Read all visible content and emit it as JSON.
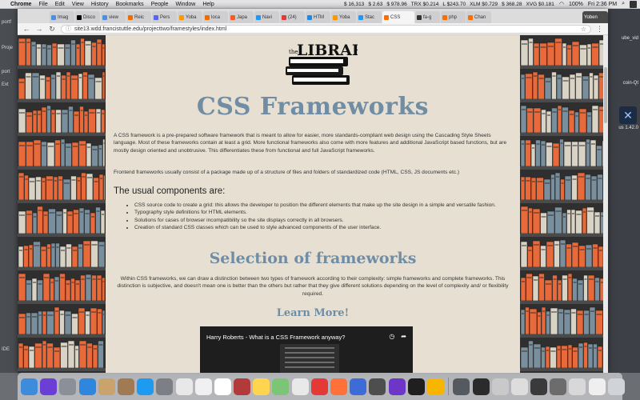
{
  "menubar": {
    "app_name": "Chrome",
    "menus": [
      "File",
      "Edit",
      "View",
      "History",
      "Bookmarks",
      "People",
      "Window",
      "Help"
    ],
    "ticker": [
      "$ 16,313",
      "$ 2.63",
      "$ 978.96",
      "TRX $0.214",
      "L $243.70",
      "XLM $0.729",
      "$ 368.28",
      "XVG $0.181"
    ],
    "battery": "100%",
    "clock": "Fri 2:36 PM"
  },
  "desktop": {
    "left_labels": [
      "portf",
      "Proje",
      "port",
      "Ext",
      "IDE"
    ],
    "right_labels": [
      "ube_vid",
      "coin-Qt",
      "us 1.42.0"
    ],
    "right_icon": "x-logo-icon"
  },
  "browser": {
    "tabs": [
      {
        "label": "Imag",
        "color": "#4a8fe7"
      },
      {
        "label": "Disco",
        "color": "#000000"
      },
      {
        "label": "view",
        "color": "#4a8fe7"
      },
      {
        "label": "Reic",
        "color": "#ef6c00"
      },
      {
        "label": "Pers",
        "color": "#5865f2"
      },
      {
        "label": "Yoba",
        "color": "#ff9800"
      },
      {
        "label": "loca",
        "color": "#ef6c00"
      },
      {
        "label": "Japa",
        "color": "#ff5722"
      },
      {
        "label": "Navi",
        "color": "#2196f3"
      },
      {
        "label": "(24)",
        "color": "#e53935"
      },
      {
        "label": "HTM",
        "color": "#1e88e5"
      },
      {
        "label": "Yoba",
        "color": "#ff9800"
      },
      {
        "label": "Stac",
        "color": "#2196f3"
      },
      {
        "label": "CSS",
        "color": "#ff6d00"
      },
      {
        "label": "fa-g",
        "color": "#333333"
      },
      {
        "label": "php",
        "color": "#ff6d00"
      },
      {
        "label": "Chan",
        "color": "#ff6d00"
      }
    ],
    "active_tab_index": 13,
    "user_badge": "Yoben",
    "url": "site13.wdd.francistuttle.edu/projecttwo/framestyles/index.html"
  },
  "page": {
    "logo_text": "the LIBRARY",
    "title": "CSS Frameworks",
    "intro": "A CSS framework is a pre-prepared software framework that is meant to allow for easier, more standards-compliant web design using the Cascading Style Sheets language. Most of these frameworks contain at least a grid. More functional frameworks also come with more features and additional JavaScript based functions, but are mostly design oriented and unobtrusive. This differentiates these from functional and full JavaScript frameworks.",
    "intro2": "Frontend frameworks usually consist of a package made up of a structure of files and folders of standardized code (HTML, CSS, JS documents etc.)",
    "components_heading": "The usual components are:",
    "components": [
      "CSS source code to create a grid: this allows the developer to position the different elements that make up the site design in a simple and versatile fashion.",
      "Typography style definitions for HTML elements.",
      "Solutions for cases of browser incompatibility so the site displays correctly in all browsers.",
      "Creation of standard CSS classes which can be used to style advanced components of the user interface."
    ],
    "selection_heading": "Selection of frameworks",
    "selection_text": "Within CSS frameworks, we can draw a distinction between two types of framework according to their complexity: simple frameworks and complete frameworks. This distinction is subjective, and doesn't mean one is better than the others but rather that they give different solutions depending on the level of complexity and/ or flexibility required.",
    "learn_heading": "Learn More!",
    "video_title": "Harry Roberts - What is a CSS Framework anyway?"
  },
  "dock": {
    "apps": [
      {
        "name": "finder",
        "color": "#3d8bdb"
      },
      {
        "name": "siri",
        "color": "#6b3fd6"
      },
      {
        "name": "launchpad",
        "color": "#8a8f98"
      },
      {
        "name": "safari",
        "color": "#2e86de"
      },
      {
        "name": "mail",
        "color": "#c9a36b"
      },
      {
        "name": "contacts",
        "color": "#a07a53"
      },
      {
        "name": "app-store",
        "color": "#1d9bf0"
      },
      {
        "name": "system-preferences",
        "color": "#7c7f85"
      },
      {
        "name": "photos",
        "color": "#e8e8e8"
      },
      {
        "name": "preview",
        "color": "#f0f0f0"
      },
      {
        "name": "calendar",
        "color": "#ffffff"
      },
      {
        "name": "dictionary",
        "color": "#b23a3a"
      },
      {
        "name": "notes",
        "color": "#ffd54f"
      },
      {
        "name": "maps",
        "color": "#7cc576"
      },
      {
        "name": "chrome",
        "color": "#e9e9e9"
      },
      {
        "name": "opera",
        "color": "#e53935"
      },
      {
        "name": "firefox",
        "color": "#ff7139"
      },
      {
        "name": "firefox-dev",
        "color": "#3d6bd8"
      },
      {
        "name": "sublime-text",
        "color": "#4e4e4e"
      },
      {
        "name": "phpstorm",
        "color": "#6e35c9"
      },
      {
        "name": "terminal",
        "color": "#1f1f1f"
      },
      {
        "name": "sketch",
        "color": "#f7b500"
      }
    ],
    "recent": [
      {
        "name": "window-1",
        "color": "#555a60"
      },
      {
        "name": "window-2",
        "color": "#2b2b2b"
      },
      {
        "name": "window-3",
        "color": "#c9c9c9"
      },
      {
        "name": "window-4",
        "color": "#dddddd"
      },
      {
        "name": "window-5",
        "color": "#3a3a3a"
      },
      {
        "name": "window-6",
        "color": "#6c6c6c"
      },
      {
        "name": "window-7",
        "color": "#d8d8d8"
      },
      {
        "name": "window-8",
        "color": "#efefef"
      }
    ],
    "trash": {
      "name": "trash",
      "color": "#d0d3d8"
    }
  },
  "colors": {
    "heading": "#708da4",
    "paper": "#e7e0d2",
    "shelf_wood": "#4a4a4a",
    "book_orange": "#e86a3a",
    "book_blue": "#7a8f9e"
  }
}
